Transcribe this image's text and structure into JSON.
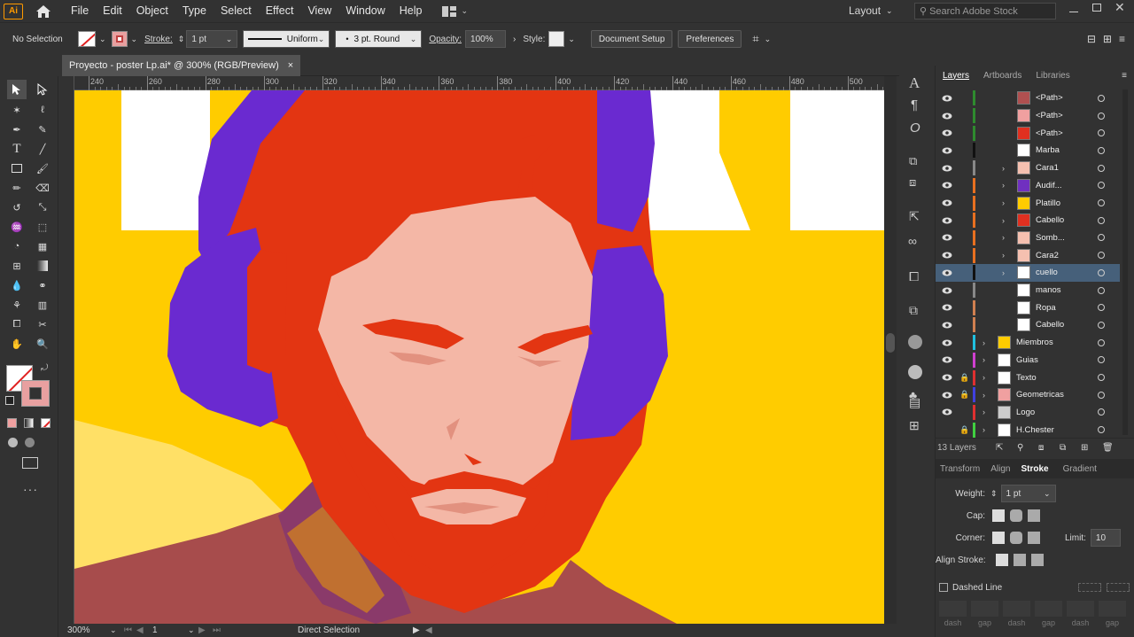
{
  "app": {
    "logo": "Ai",
    "workspace": "Layout",
    "search_placeholder": "Search Adobe Stock"
  },
  "menu": [
    "File",
    "Edit",
    "Object",
    "Type",
    "Select",
    "Effect",
    "View",
    "Window",
    "Help"
  ],
  "control": {
    "selection": "No Selection",
    "stroke_label": "Stroke:",
    "stroke_weight": "1 pt",
    "profile": "Uniform",
    "brush": "3 pt. Round",
    "opacity_label": "Opacity:",
    "opacity": "100%",
    "style_label": "Style:",
    "document_setup": "Document Setup",
    "preferences": "Preferences"
  },
  "document": {
    "tab_title": "Proyecto - poster Lp.ai* @ 300% (RGB/Preview)",
    "close": "×"
  },
  "ruler": {
    "h": [
      "240",
      "260",
      "280",
      "300",
      "320",
      "340",
      "360",
      "380",
      "400",
      "420",
      "440",
      "460",
      "480",
      "500"
    ]
  },
  "status": {
    "zoom": "300%",
    "artboard": "1",
    "tool": "Direct Selection"
  },
  "panel": {
    "tabs": [
      "Layers",
      "Artboards",
      "Libraries"
    ],
    "layers": [
      {
        "name": "<Path>",
        "color": "#2e8b2e",
        "sub": true,
        "chev": false,
        "thumb": "#b05050"
      },
      {
        "name": "<Path>",
        "color": "#2e8b2e",
        "sub": true,
        "chev": false,
        "thumb": "#f0a0a0"
      },
      {
        "name": "<Path>",
        "color": "#2e8b2e",
        "sub": true,
        "chev": false,
        "thumb": "#e03020"
      },
      {
        "name": "Marba",
        "color": "#111111",
        "sub": false,
        "chev": false,
        "thumb": "#ffffff"
      },
      {
        "name": "Cara1",
        "color": "#888888",
        "sub": false,
        "chev": true,
        "thumb": "#f5c0b0"
      },
      {
        "name": "Audif...",
        "color": "#e87020",
        "sub": false,
        "chev": true,
        "thumb": "#7030c0"
      },
      {
        "name": "Platillo",
        "color": "#e87020",
        "sub": false,
        "chev": true,
        "thumb": "#ffcc00"
      },
      {
        "name": "Cabello",
        "color": "#e87020",
        "sub": false,
        "chev": true,
        "thumb": "#e03020"
      },
      {
        "name": "Somb...",
        "color": "#e87020",
        "sub": false,
        "chev": true,
        "thumb": "#f5c0b0"
      },
      {
        "name": "Cara2",
        "color": "#e87020",
        "sub": false,
        "chev": true,
        "thumb": "#f5c0b0"
      },
      {
        "name": "cuello",
        "color": "#111111",
        "sub": false,
        "chev": true,
        "thumb": "#ffffff",
        "selected": true
      },
      {
        "name": "manos",
        "color": "#888888",
        "sub": false,
        "chev": false,
        "thumb": "#ffffff"
      },
      {
        "name": "Ropa",
        "color": "#d08050",
        "sub": false,
        "chev": false,
        "thumb": "#ffffff"
      },
      {
        "name": "Cabello",
        "color": "#d08050",
        "sub": false,
        "chev": false,
        "thumb": "#ffffff"
      },
      {
        "name": "Miembros",
        "color": "#20c0e0",
        "top": true,
        "chev": true,
        "thumb": "#ffcc00"
      },
      {
        "name": "Guias",
        "color": "#d040d0",
        "top": true,
        "chev": true,
        "thumb": "#ffffff"
      },
      {
        "name": "Texto",
        "color": "#e03030",
        "top": true,
        "chev": true,
        "lock": true,
        "thumb": "#ffffff"
      },
      {
        "name": "Geometricas",
        "color": "#4040e0",
        "top": true,
        "chev": true,
        "lock": true,
        "thumb": "#f0a0a0"
      },
      {
        "name": "Logo",
        "color": "#e03030",
        "top": true,
        "chev": true,
        "thumb": "#cccccc"
      },
      {
        "name": "H.Chester",
        "color": "#40d040",
        "top": true,
        "chev": true,
        "lock": true,
        "noeye": true,
        "thumb": "#ffffff"
      }
    ],
    "layer_count": "13 Layers",
    "props_tabs": [
      "Transform",
      "Align",
      "Stroke",
      "Gradient"
    ],
    "stroke": {
      "weight_label": "Weight:",
      "weight": "1 pt",
      "cap_label": "Cap:",
      "corner_label": "Corner:",
      "limit_label": "Limit:",
      "limit": "10",
      "align_label": "Align Stroke:",
      "dashed_label": "Dashed Line",
      "dash_labels": [
        "dash",
        "gap",
        "dash",
        "gap",
        "dash",
        "gap"
      ]
    }
  }
}
